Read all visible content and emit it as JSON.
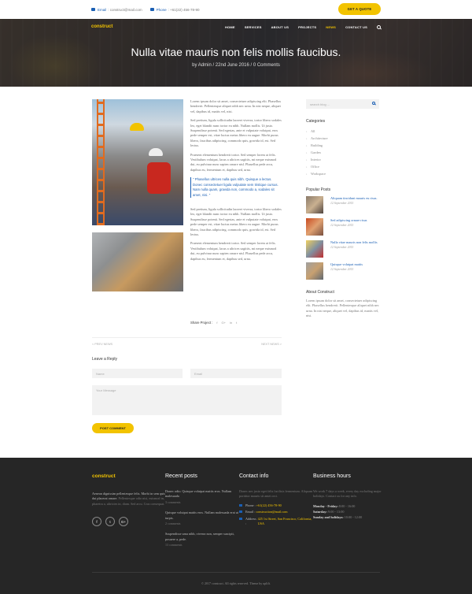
{
  "topbar": {
    "email_label": "Email",
    "email_value": ": construct@mail.com",
    "phone_label": "Phone",
    "phone_value": ": +61(22) 456-78-90",
    "quote_button": "GET A QUOTE"
  },
  "nav": {
    "logo": "construct",
    "items": [
      "HOME",
      "SERVICES",
      "ABOUT US",
      "PROJECTS",
      "NEWS",
      "CONTACT US"
    ],
    "active_index": 4
  },
  "hero": {
    "title": "Nulla vitae mauris non felis mollis faucibus.",
    "meta": "by Admin / 22nd June 2016 / 0 Comments"
  },
  "post": {
    "para1": "Lorem ipsum dolor sit amet, consectetuer adipiscing elit. Phasellus hendrerit. Pellentesque aliquet nibh nec urna. In nisi neque, aliquet vel, dapibus id, mattis vel, nisi.",
    "para2": "Sed pretium, ligula sollicitudin laoreet viverra, tortor libero sodales leo, eget blandit nunc tortor eu nibh. Nullam mollis. Ut justo. Suspendisse potenti. Sed egestas, ante et vulputate volutpat, eros pede semper est, vitae luctus metus libero eu augue. Morbi purus libero, faucibus adipiscing, commodo quis, gravida id, est. Sed lectus.",
    "para3": "Praesent elementum hendrerit tortor. Sed semper lorem at felis. Vestibulum volutpat, lacus a ultrices sagittis, mi neque euismod dui, eu pulvinar nunc sapien ornare nisl. Phasellus pede arcu, dapibus eu, fermentum et, dapibus sed, urna.",
    "quote": "\" Phasellus ultrices nulla quis nibh. Quisque a lectus. Donec consectetuer ligula vulputate sem tristique cursus. Nam nulla quam, gravida non, commodo a, sodales sit amet, nisi. \"",
    "para4": "Sed pretium, ligula sollicitudin laoreet viverra, tortor libero sodales leo, eget blandit nunc tortor eu nibh. Nullam mollis. Ut justo. Suspendisse potenti. Sed egestas, ante et vulputate volutpat, eros pede semper est, vitae luctus metus libero eu augue. Morbi purus libero, faucibus adipiscing, commodo quis, gravida id, est. Sed lectus.",
    "para5": "Praesent elementum hendrerit tortor. Sed semper lorem at felis. Vestibulum volutpat, lacus a ultrices sagittis, mi neque euismod dui, eu pulvinar nunc sapien ornare nisl. Phasellus pede arcu, dapibus eu, fermentum et, dapibus sed, urna.",
    "share_label": "Share Project :",
    "share_icons": [
      "f",
      "G+",
      "in",
      "t"
    ],
    "prev": "< PREV NEWS",
    "next": "NEXT NEWS >"
  },
  "reply": {
    "heading": "Leave a Reply",
    "name_placeholder": "Name",
    "email_placeholder": "Email",
    "message_placeholder": "Your Message",
    "submit": "POST COMMENT"
  },
  "sidebar": {
    "search_placeholder": "search blog ...",
    "categories_heading": "Categories",
    "categories": [
      "All",
      "Architecture",
      "Building",
      "Garden",
      "Interior",
      "Office",
      "Workspace"
    ],
    "popular_heading": "Popular Posts",
    "popular": [
      {
        "title": "Aliquam tincidunt mauris eu risus.",
        "date": "12 September 2015"
      },
      {
        "title": "Sed adipiscing ornare risus",
        "date": "12 September 2015"
      },
      {
        "title": "Nulla vitae mauris non felis mollis",
        "date": "12 September 2015"
      },
      {
        "title": "Quisque volutpat mattis",
        "date": "12 September 2015"
      }
    ],
    "about_heading": "About Construct",
    "about_text": "Lorem ipsum dolor sit amet, consectetuer adipiscing elit. Phasellus hendrerit. Pellentesque aliquet nibh nec urna. In nisi neque, aliquet vel, dapibus id, mattis vel, nisi."
  },
  "footer": {
    "logo": "construct",
    "about": "Aenean dignissim pellentesque felis. Morbi in sem quis dui placerat ornare.",
    "about_dim": "Pellentesque odio nisi, euismod in, pharetra a, ultricies in, diam. Sed arcu. Cras consequat.",
    "social": [
      "f",
      "t",
      "G+"
    ],
    "recent_heading": "Recent posts",
    "recent": [
      {
        "title": "Donec odio. Quisque volutpat mattis eros. Nullam malesuada",
        "comments": "3 comments"
      },
      {
        "title": "Quisque volutpat mattis eros. Nullam malesuada erat ut turpis.",
        "comments": "2 comments"
      },
      {
        "title": "Suspendisse urna nibh, viverra non, semper suscipit, posuere a, pede.",
        "comments": "13 comments"
      }
    ],
    "contact_heading": "Contact info",
    "contact_text": "Donec nec justo eget felis facilisis fermentum. Aliquam porttitor mauris sit amet orci.",
    "phone_label": "Phone :",
    "phone": "+61(22) 456-78-90",
    "email_label": "Email :",
    "email": "construction@mail.com",
    "address_label": "Address :",
    "address": "425 1st Street, San Francisco, California, USA",
    "hours_heading": "Business hours",
    "hours_text": "We work 7 days a week, every day excluding major holidays. Contact us for any info.",
    "hours": [
      {
        "day": "Monday - Friday:",
        "time": "8:00 - 16:00"
      },
      {
        "day": "Saturday:",
        "time": "9:00 - 13:00"
      },
      {
        "day": "Sunday and holidays:",
        "time": "10:00 - 12:00"
      }
    ],
    "copyright": "© 2017 construct. All rights reserved. Theme by uplift."
  }
}
